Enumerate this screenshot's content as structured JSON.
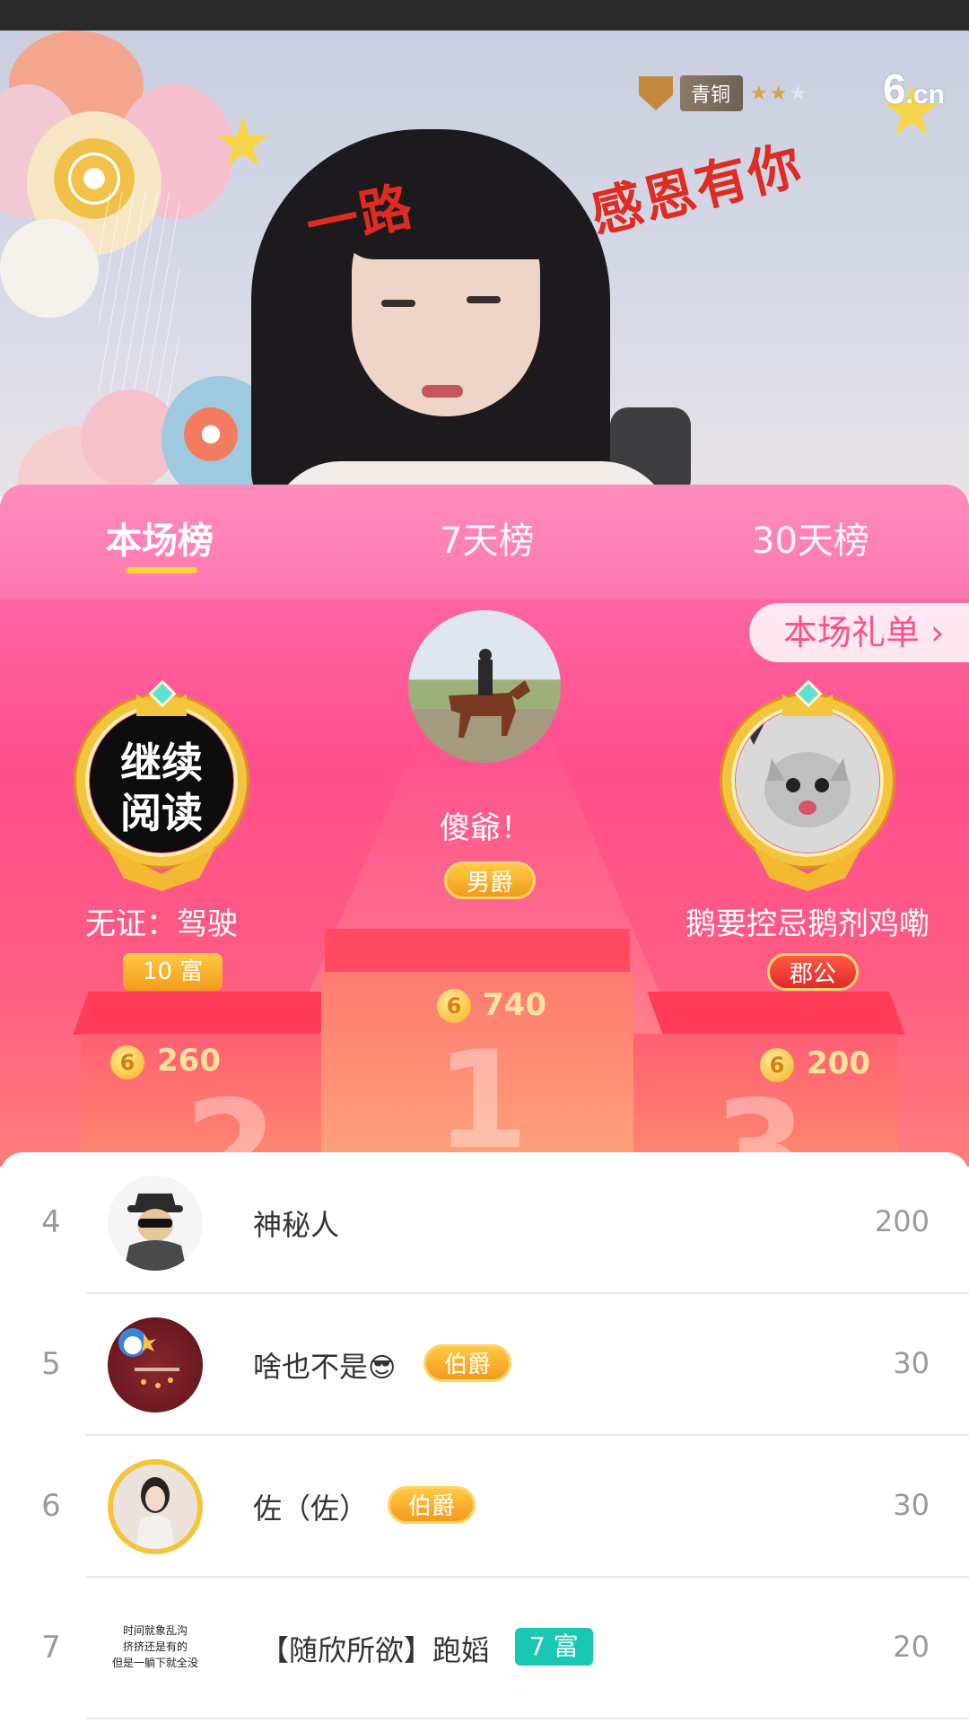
{
  "stream": {
    "rank_label": "青铜",
    "rank_stars": "★★",
    "rank_stars_dim": "★",
    "logo_main": "6",
    "logo_suffix": ".cn",
    "banner_left": "一路",
    "banner_right": "感恩有你"
  },
  "tabs": [
    {
      "label": "本场榜",
      "active": true
    },
    {
      "label": "7天榜",
      "active": false
    },
    {
      "label": "30天榜",
      "active": false
    }
  ],
  "gift_list_label": "本场礼单 ›",
  "podium": {
    "first": {
      "name": "傻爺！",
      "tag": "男爵",
      "score": "740",
      "rank": "1"
    },
    "second": {
      "name": "无证：驾驶",
      "tag": "10 富",
      "score": "260",
      "rank": "2",
      "avatar_text": [
        "继续",
        "阅读"
      ]
    },
    "third": {
      "name": "鹅要控忌鹅剂鸡嘞",
      "tag": "郡公",
      "score": "200",
      "rank": "3"
    }
  },
  "coin_symbol": "6",
  "list": [
    {
      "rank": "4",
      "name": "神秘人",
      "points": "200"
    },
    {
      "rank": "5",
      "name": "啥也不是",
      "emoji": "😎",
      "tag": "伯爵",
      "points": "30"
    },
    {
      "rank": "6",
      "name": "佐（佐）",
      "tag": "伯爵",
      "points": "30"
    },
    {
      "rank": "7",
      "name": "【随欣所欲】跑嫍",
      "tag": "7 富",
      "points": "20",
      "avatar_text": [
        "时间就象乱沟",
        "挤挤还是有的",
        "但是一躺下就全没"
      ]
    }
  ],
  "colors": {
    "panel_pink": "#ff4f8d",
    "tab_pink": "#ff86b9",
    "gold": "#f5c43d",
    "teal_badge": "#19c7b3"
  }
}
